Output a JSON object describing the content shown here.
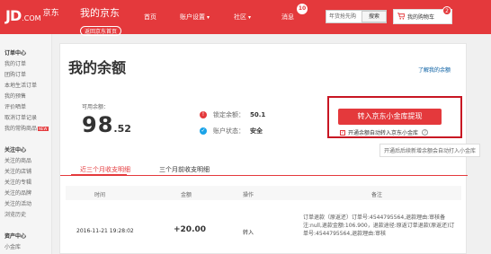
{
  "header": {
    "logo_main": "JD",
    "logo_sub": ".COM",
    "logo_cn": "京东",
    "title": "我的京东",
    "back_home": "返回京东首页",
    "nav": [
      {
        "label": "首页",
        "caret": false
      },
      {
        "label": "账户设置",
        "caret": true
      },
      {
        "label": "社区",
        "caret": true
      },
      {
        "label": "消息",
        "caret": false
      }
    ],
    "message_count": "10",
    "search_value": "年货抢先购",
    "search_button": "搜索",
    "cart_label": "我的购物车",
    "cart_count": "2"
  },
  "sidebar": {
    "groups": [
      {
        "title": "订单中心",
        "items": [
          "我的订单",
          "团购订单",
          "本地生活订单",
          "我的预售",
          "评价晒单",
          "取消订单记录",
          "我的常购商品"
        ]
      },
      {
        "title": "关注中心",
        "items": [
          "关注的商品",
          "关注的店铺",
          "关注的专辑",
          "关注的品牌",
          "关注的活动",
          "浏览历史"
        ]
      },
      {
        "title": "资产中心",
        "items": [
          "小金库"
        ]
      }
    ],
    "new_tag": "NEW"
  },
  "main": {
    "title": "我的余额",
    "help_link": "了解我的余额",
    "available_label": "可用余额：",
    "available_int": "98",
    "available_dec": ".52",
    "locked_label": "锁定余额：",
    "locked_value": "50.1",
    "status_label": "账户状态：",
    "status_value": "安全",
    "withdraw_button": "转入京东小金库提现",
    "auto_transfer_label": "开通余额自动转入京东小金库",
    "tooltip": "开通后后续新增余额会自动打入小金库",
    "tabs": [
      "近三个月收支明细",
      "三个月前收支明细"
    ],
    "table_headers": [
      "时间",
      "金额",
      "操作",
      "备注"
    ],
    "rows": [
      {
        "time": "2016-11-21 19:28:02",
        "amount": "+20.00",
        "operation": "转入",
        "remark": "订单退款（原返还）订单号:4544795564,退款理由:审核备注:null,退款金额:106.900，退款途径:原返订单退款(原返还)订单号:4544795564,退款理由:审核"
      }
    ]
  },
  "colors": {
    "brand_red": "#e4393c",
    "frame_red": "#c81623",
    "link_blue": "#005aa0",
    "info_blue": "#1aa3e8"
  }
}
